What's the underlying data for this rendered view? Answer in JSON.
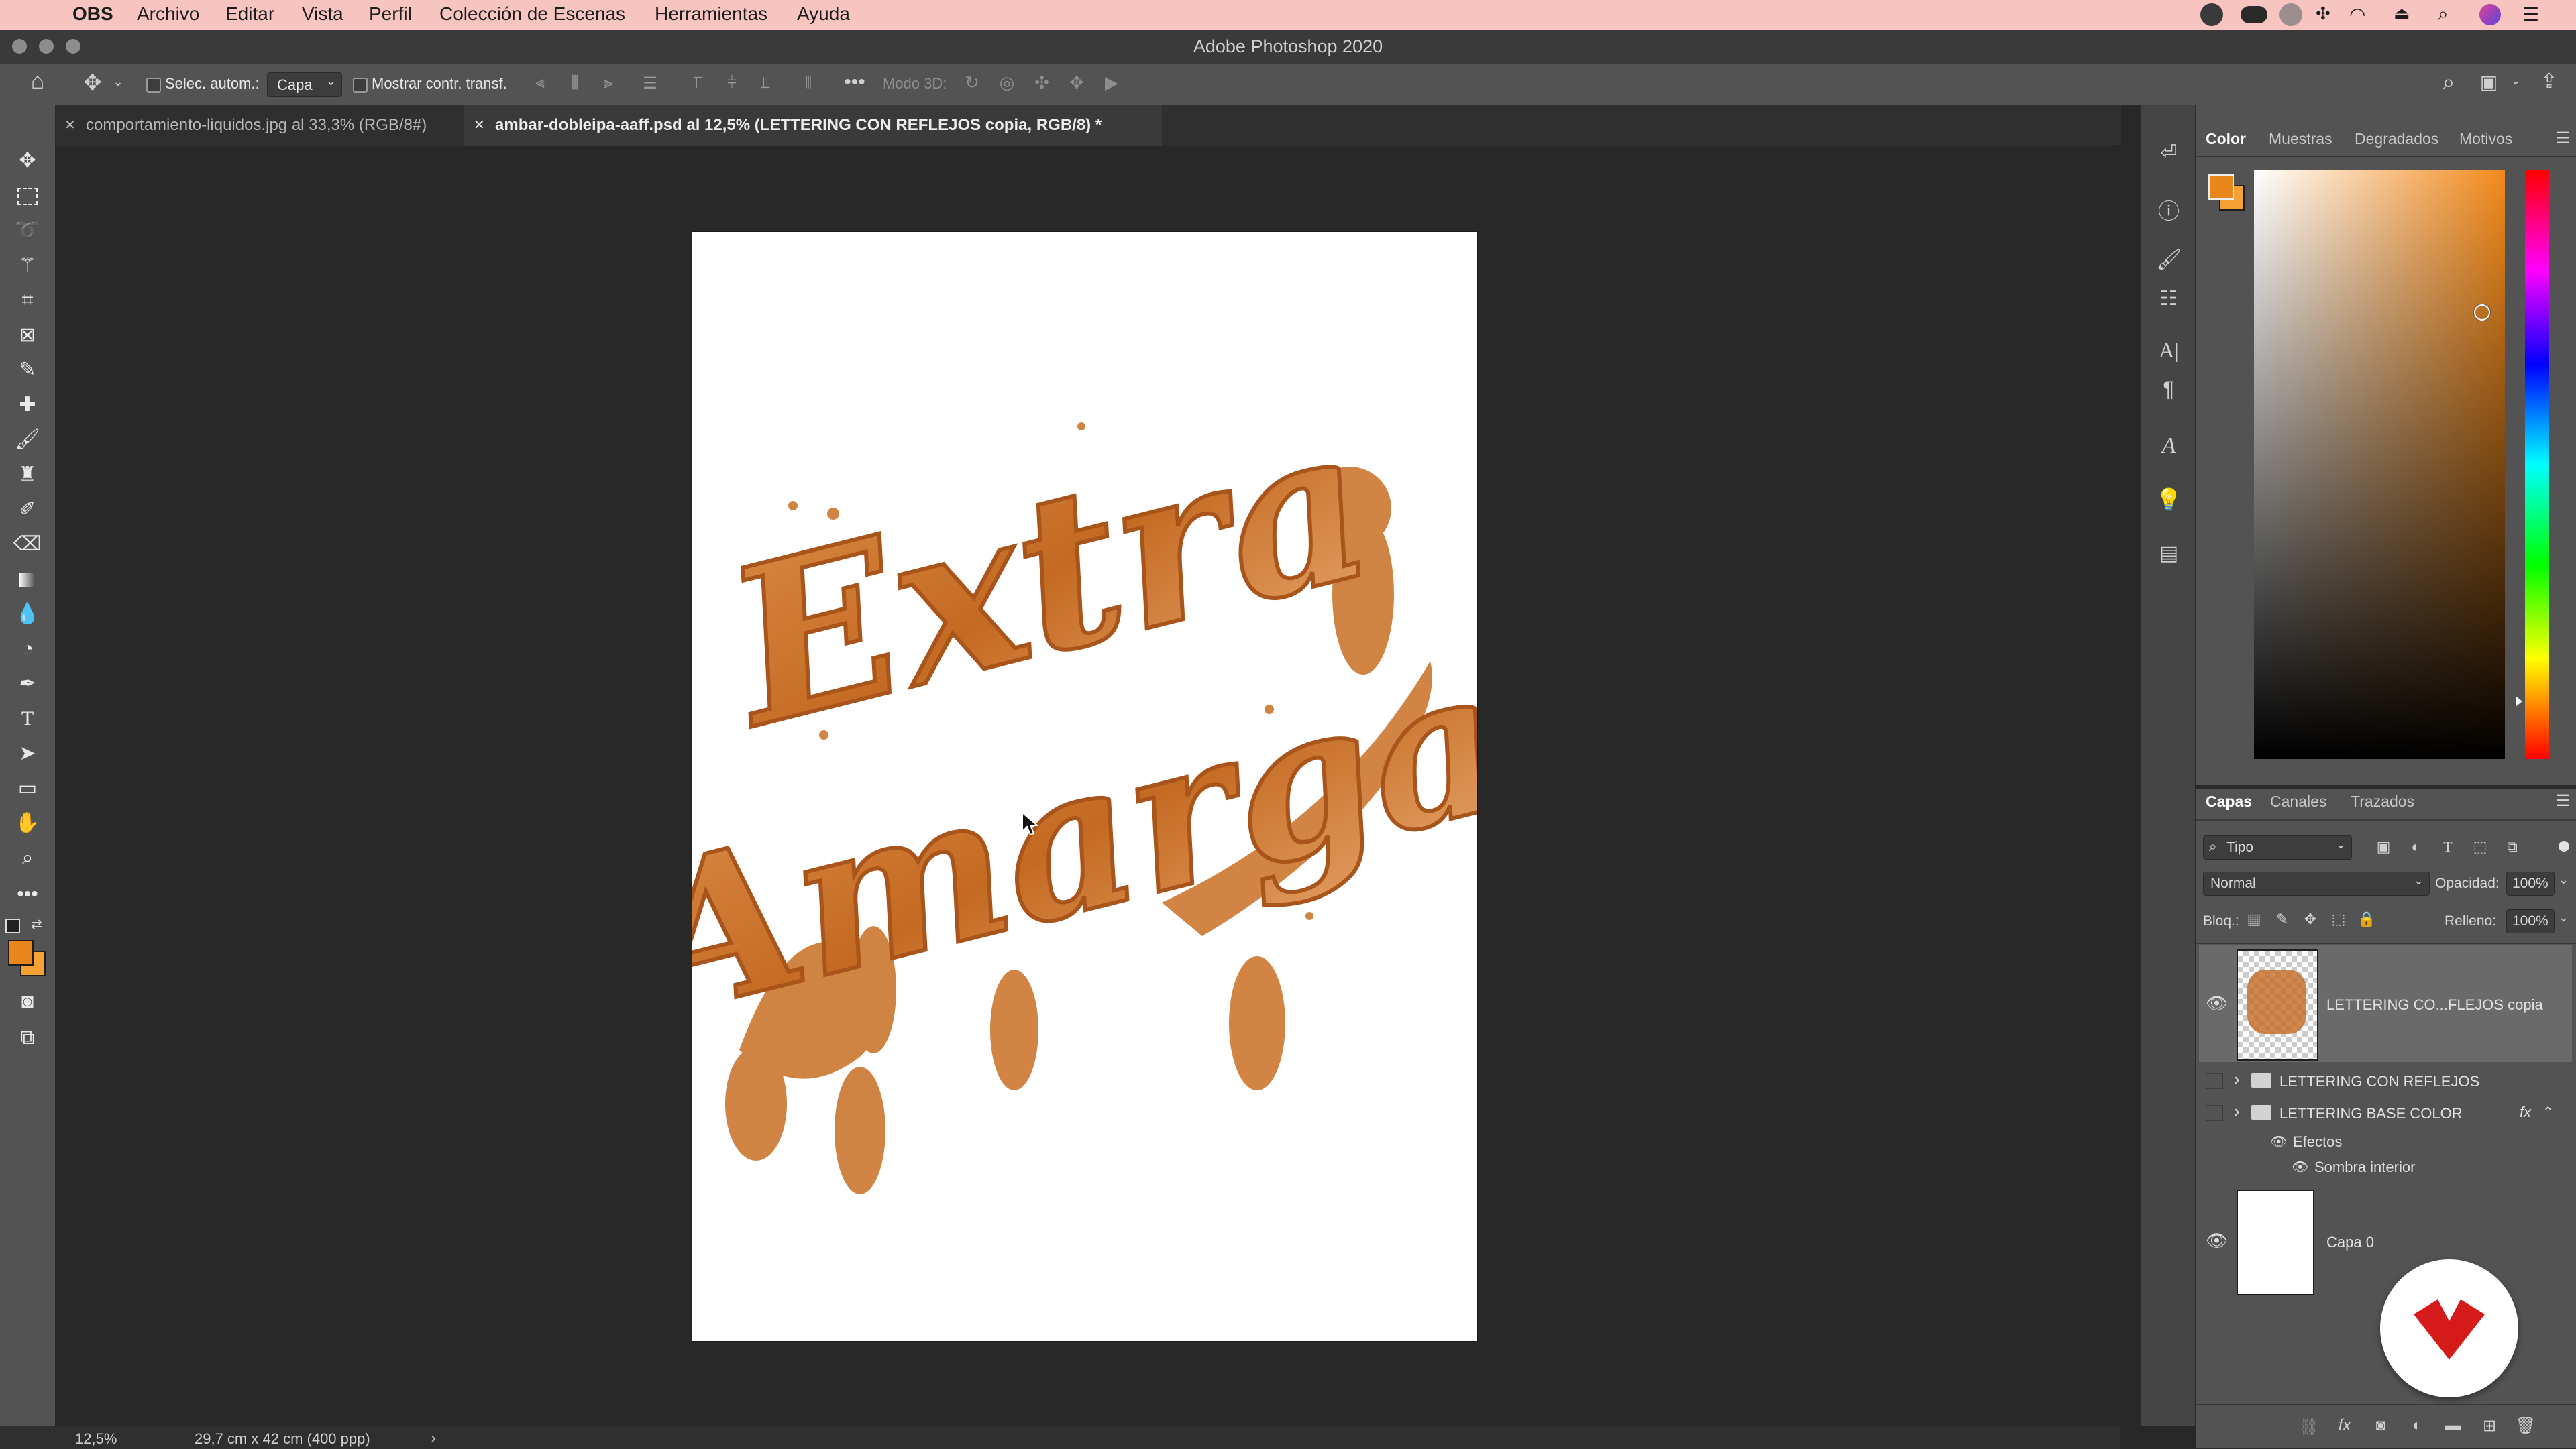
{
  "menubar": {
    "app_name": "OBS",
    "items": [
      "Archivo",
      "Editar",
      "Vista",
      "Perfil",
      "Colección de Escenas",
      "Herramientas",
      "Ayuda"
    ]
  },
  "window": {
    "title": "Adobe Photoshop 2020"
  },
  "options_bar": {
    "auto_select_label": "Selec. autom.:",
    "auto_select_value": "Capa",
    "show_transform_label": "Mostrar contr. transf.",
    "mode_3d_label": "Modo 3D:"
  },
  "tabs": [
    {
      "label": "comportamiento-liquidos.jpg al 33,3% (RGB/8#)",
      "active": false
    },
    {
      "label": "ambar-dobleipa-aaff.psd al 12,5% (LETTERING CON REFLEJOS copia, RGB/8) *",
      "active": true
    }
  ],
  "canvas": {
    "lettering_line1": "Extra",
    "lettering_line2": "Amarga",
    "lettering_color": "#c46a22"
  },
  "status": {
    "zoom": "12,5%",
    "doc_size": "29,7 cm x 42 cm (400 ppp)"
  },
  "color_panel": {
    "tabs": [
      "Color",
      "Muestras",
      "Degradados",
      "Motivos"
    ],
    "foreground": "#e8861c",
    "background": "#f4a234"
  },
  "layers_panel": {
    "tabs": [
      "Capas",
      "Canales",
      "Trazados"
    ],
    "filter_label": "Tipo",
    "blend_mode": "Normal",
    "opacity_label": "Opacidad:",
    "opacity_value": "100%",
    "lock_label": "Bloq.:",
    "fill_label": "Relleno:",
    "fill_value": "100%",
    "layers": [
      {
        "name": "LETTERING CO...FLEJOS copia",
        "visible": true,
        "type": "pixel"
      },
      {
        "name": "LETTERING CON REFLEJOS",
        "visible": false,
        "type": "group"
      },
      {
        "name": "LETTERING BASE COLOR",
        "visible": false,
        "type": "group",
        "fx": "fx"
      },
      {
        "name": "Efectos",
        "type": "effects-header"
      },
      {
        "name": "Sombra interior",
        "type": "effect"
      },
      {
        "name": "Capa 0",
        "visible": true,
        "type": "pixel"
      }
    ]
  }
}
